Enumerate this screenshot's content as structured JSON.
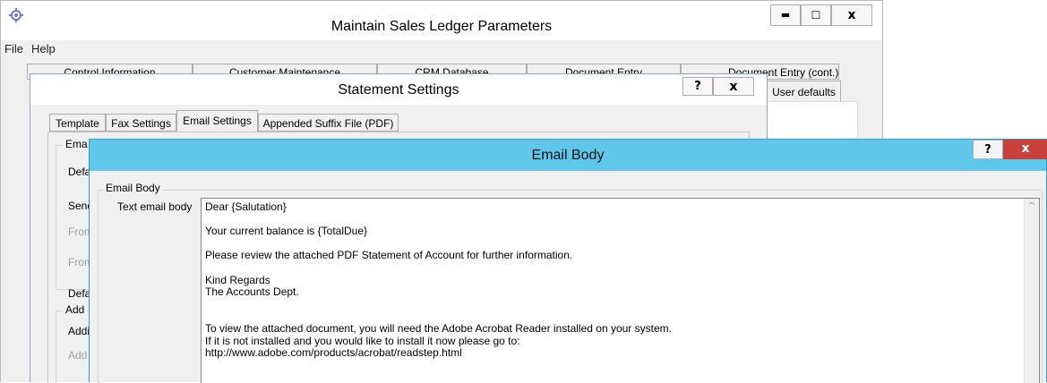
{
  "main_window": {
    "title": "Maintain Sales Ledger Parameters",
    "minimize_glyph": "▬",
    "maximize_glyph": "☐",
    "close_glyph": "x",
    "menu": [
      "File",
      "Help"
    ],
    "tabs": [
      "Control Information",
      "Customer Maintenance",
      "CRM Database",
      "Document Entry",
      "Document Entry (cont.)"
    ],
    "subtab": "User defaults"
  },
  "statement_window": {
    "title": "Statement Settings",
    "help_glyph": "?",
    "close_glyph": "x",
    "tabs": [
      "Template",
      "Fax Settings",
      "Email Settings",
      "Appended Suffix File (PDF)"
    ],
    "active_tab": "Email Settings",
    "group1_label": "Ema",
    "fields": [
      "Defa",
      "Send",
      "From",
      "From",
      "Defa"
    ],
    "group2_label": "Add",
    "fields2": [
      "Addi",
      "Add"
    ]
  },
  "email_window": {
    "title": "Email Body",
    "help_glyph": "?",
    "close_glyph": "x",
    "group_label": "Email Body",
    "field_label": "Text email body",
    "body_text": "Dear {Salutation}\n\nYour current balance is {TotalDue}\n\nPlease review the attached PDF Statement of Account for further information.\n\nKind Regards\nThe Accounts Dept.\n\n\nTo view the attached document, you will need the Adobe Acrobat Reader installed on your system.\nIf it is not installed and you would like to install it now please go to:\nhttp://www.adobe.com/products/acrobat/readstep.html",
    "scroll_up_glyph": "^"
  },
  "colors": {
    "email_titlebar": "#5ec7ea",
    "close_red": "#c7413a",
    "window_bg": "#f0f0f0"
  }
}
